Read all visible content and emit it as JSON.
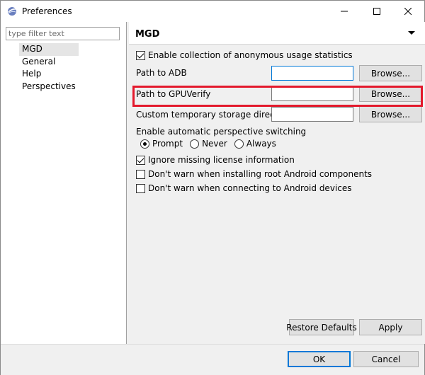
{
  "window": {
    "title": "Preferences"
  },
  "left": {
    "filter_placeholder": "type filter text",
    "tree": [
      {
        "label": "MGD",
        "selected": true
      },
      {
        "label": "General"
      },
      {
        "label": "Help"
      },
      {
        "label": "Perspectives"
      }
    ]
  },
  "page": {
    "title": "MGD",
    "usage_stats_label": "Enable collection of anonymous usage statistics",
    "adb_label": "Path to ADB",
    "adb_value": "",
    "adb_browse": "Browse...",
    "gpu_label": "Path to GPUVerify",
    "gpu_value": "",
    "gpu_browse": "Browse...",
    "storage_label": "Custom temporary storage directory",
    "storage_value": "",
    "storage_browse": "Browse...",
    "perspective_label": "Enable automatic perspective switching",
    "radio_prompt": "Prompt",
    "radio_never": "Never",
    "radio_always": "Always",
    "ignore_license_label": "Ignore missing license information",
    "root_android_label": "Don't warn when installing root Android components",
    "connect_android_label": "Don't warn when connecting to Android devices",
    "restore_defaults": "Restore Defaults",
    "apply": "Apply"
  },
  "footer": {
    "ok": "OK",
    "cancel": "Cancel"
  },
  "colors": {
    "highlight": "#e3192c",
    "focus": "#0078d7"
  }
}
